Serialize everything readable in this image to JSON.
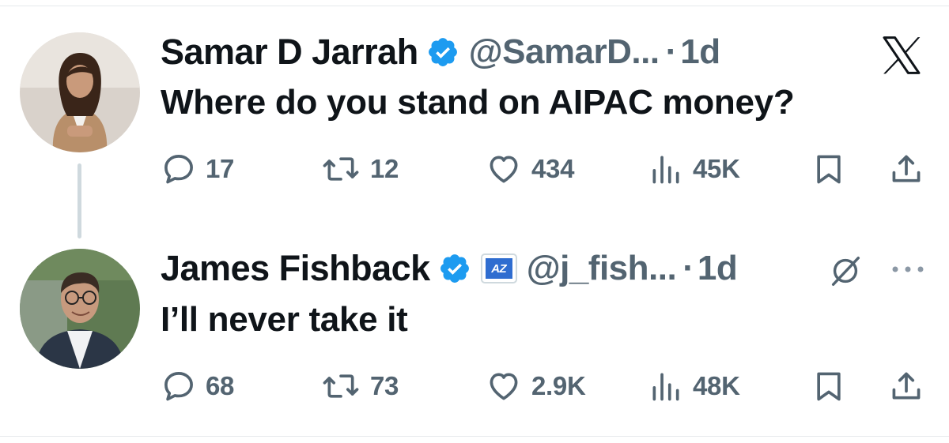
{
  "tweets": [
    {
      "name": "Samar D Jarrah",
      "handle": "@SamarD...",
      "dot": "·",
      "time": "1d",
      "text": "Where do you stand on AIPAC money?",
      "replies": "17",
      "retweets": "12",
      "likes": "434",
      "views": "45K"
    },
    {
      "name": "James Fishback",
      "affiliate_badge": "AZ",
      "handle": "@j_fish...",
      "dot": "·",
      "time": "1d",
      "text": "I’ll never take it",
      "replies": "68",
      "retweets": "73",
      "likes": "2.9K",
      "views": "48K"
    }
  ],
  "colors": {
    "text_primary": "#0f1419",
    "text_secondary": "#536471",
    "verified_blue": "#1d9bf0",
    "thread_line": "#cfd9de",
    "affiliate_blue": "#2f6dd0"
  },
  "icons": {
    "reply": "reply-icon",
    "retweet": "retweet-icon",
    "like": "like-icon",
    "views": "views-icon",
    "bookmark": "bookmark-icon",
    "share": "share-icon",
    "logo": "x-logo-icon",
    "grok": "grok-icon",
    "more": "more-icon",
    "verified": "verified-badge-icon"
  }
}
